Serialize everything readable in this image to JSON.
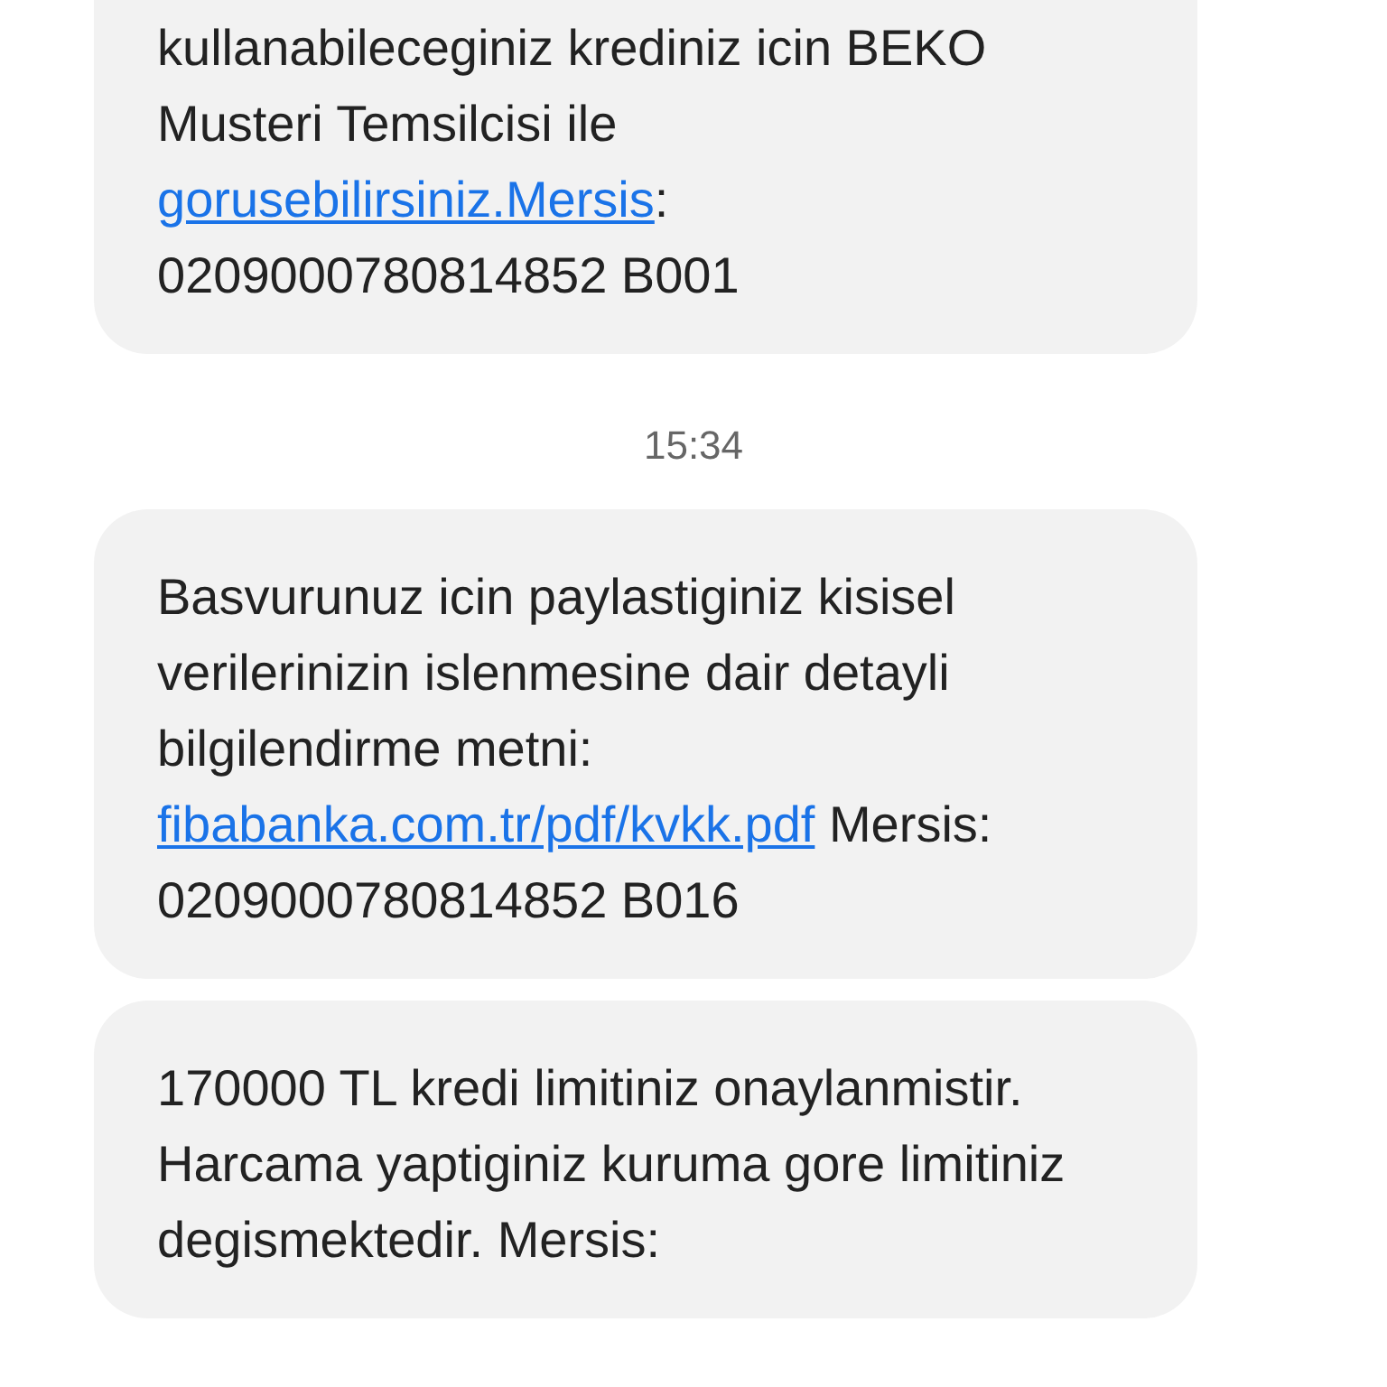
{
  "messages": [
    {
      "parts": [
        {
          "kind": "text",
          "text": "kullanabileceginiz krediniz icin BEKO Musteri Temsilcisi ile "
        },
        {
          "kind": "link",
          "text": "gorusebilirsiniz.Mersis"
        },
        {
          "kind": "text",
          "text": ": 0209000780814852 B001"
        }
      ]
    },
    {
      "time": "15:34",
      "parts": [
        {
          "kind": "text",
          "text": "Basvurunuz icin paylastiginiz kisisel verilerinizin islenmesine dair detayli bilgilendirme metni: "
        },
        {
          "kind": "link",
          "text": "fibabanka.com.tr/pdf/kvkk.pdf"
        },
        {
          "kind": "text",
          "text": " Mersis: 0209000780814852 B016"
        }
      ]
    },
    {
      "parts": [
        {
          "kind": "text",
          "text": "170000 TL kredi limitiniz onaylanmistir. Harcama yaptiginiz kuruma gore limitiniz degismektedir. Mersis:"
        }
      ]
    }
  ]
}
